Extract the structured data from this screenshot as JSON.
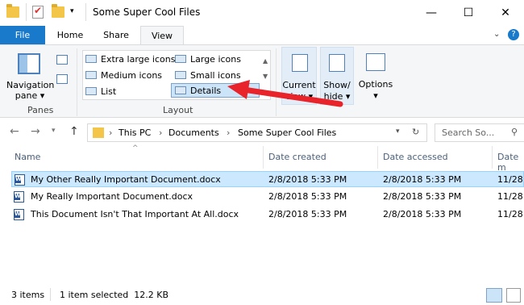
{
  "window": {
    "title": "Some Super Cool Files",
    "controls": [
      "minimize",
      "maximize",
      "close"
    ]
  },
  "ribbon_tabs": [
    "File",
    "Home",
    "Share",
    "View"
  ],
  "ribbon": {
    "panes_group": {
      "nav_pane_label_1": "Navigation",
      "nav_pane_label_2": "pane",
      "label": "Panes"
    },
    "layout_group": {
      "label": "Layout",
      "items": [
        "Extra large icons",
        "Large icons",
        "Medium icons",
        "Small icons",
        "List",
        "Details"
      ]
    },
    "current_view": {
      "label_1": "Current",
      "label_2": "view"
    },
    "show_hide": {
      "label_1": "Show/",
      "label_2": "hide"
    },
    "options": {
      "label": "Options"
    }
  },
  "address": {
    "breadcrumbs": [
      "This PC",
      "Documents",
      "Some Super Cool Files"
    ],
    "search_placeholder": "Search So..."
  },
  "columns": [
    "Name",
    "Date created",
    "Date accessed",
    "Date m"
  ],
  "files": [
    {
      "name": "My Other Really Important Document.docx",
      "created": "2/8/2018 5:33 PM",
      "accessed": "2/8/2018 5:33 PM",
      "modified": "11/28"
    },
    {
      "name": "My Really Important Document.docx",
      "created": "2/8/2018 5:33 PM",
      "accessed": "2/8/2018 5:33 PM",
      "modified": "11/28"
    },
    {
      "name": "This Document Isn't That Important At All.docx",
      "created": "2/8/2018 5:33 PM",
      "accessed": "2/8/2018 5:33 PM",
      "modified": "11/28"
    }
  ],
  "status": {
    "count": "3 items",
    "selection": "1 item selected  12.2 KB"
  },
  "colors": {
    "accent": "#1979ca",
    "selected_row": "#cce8ff",
    "arrow": "#e8232a"
  }
}
